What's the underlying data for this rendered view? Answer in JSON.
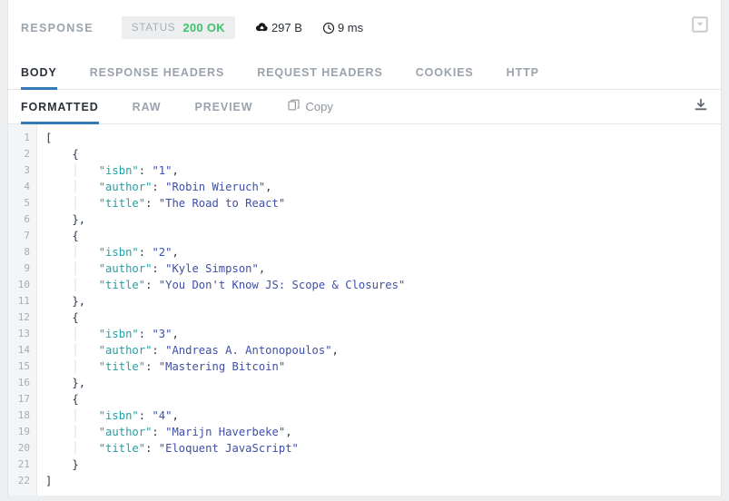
{
  "header": {
    "title": "RESPONSE",
    "status_label": "STATUS",
    "status_code": "200 OK",
    "status_color": "#3ec46d",
    "size": "297 B",
    "size_icon": "cloud-download-icon",
    "time": "9 ms",
    "time_icon": "clock-icon",
    "panel_toggle_icon": "collapse-panel-icon"
  },
  "tabs": [
    {
      "label": "BODY",
      "active": true
    },
    {
      "label": "RESPONSE HEADERS",
      "active": false
    },
    {
      "label": "REQUEST HEADERS",
      "active": false
    },
    {
      "label": "COOKIES",
      "active": false
    },
    {
      "label": "HTTP",
      "active": false
    }
  ],
  "subtabs": [
    {
      "label": "FORMATTED",
      "active": true
    },
    {
      "label": "RAW",
      "active": false
    },
    {
      "label": "PREVIEW",
      "active": false
    }
  ],
  "actions": {
    "copy_label": "Copy",
    "copy_icon": "copy-icon",
    "download_icon": "download-icon"
  },
  "editor": {
    "accent_color": "#337ab7",
    "key_color": "#1fa1a8",
    "string_color": "#3e4fa8",
    "punct_color": "#2f3a4a",
    "line_numbers": [
      1,
      2,
      3,
      4,
      5,
      6,
      7,
      8,
      9,
      10,
      11,
      12,
      13,
      14,
      15,
      16,
      17,
      18,
      19,
      20,
      21,
      22
    ],
    "lines": [
      {
        "n": 1,
        "indent": 0,
        "guide": false,
        "tokens": [
          {
            "t": "punct",
            "v": "["
          }
        ]
      },
      {
        "n": 2,
        "indent": 1,
        "guide": false,
        "tokens": [
          {
            "t": "punct",
            "v": "{"
          }
        ]
      },
      {
        "n": 3,
        "indent": 2,
        "guide": true,
        "tokens": [
          {
            "t": "key",
            "v": "\"isbn\""
          },
          {
            "t": "punct",
            "v": ": "
          },
          {
            "t": "str",
            "v": "\"1\""
          },
          {
            "t": "punct",
            "v": ","
          }
        ]
      },
      {
        "n": 4,
        "indent": 2,
        "guide": true,
        "tokens": [
          {
            "t": "key",
            "v": "\"author\""
          },
          {
            "t": "punct",
            "v": ": "
          },
          {
            "t": "str",
            "v": "\"Robin Wieruch\""
          },
          {
            "t": "punct",
            "v": ","
          }
        ]
      },
      {
        "n": 5,
        "indent": 2,
        "guide": true,
        "tokens": [
          {
            "t": "key",
            "v": "\"title\""
          },
          {
            "t": "punct",
            "v": ": "
          },
          {
            "t": "str",
            "v": "\"The Road to React\""
          }
        ]
      },
      {
        "n": 6,
        "indent": 1,
        "guide": false,
        "tokens": [
          {
            "t": "punct",
            "v": "},"
          }
        ]
      },
      {
        "n": 7,
        "indent": 1,
        "guide": false,
        "tokens": [
          {
            "t": "punct",
            "v": "{"
          }
        ]
      },
      {
        "n": 8,
        "indent": 2,
        "guide": true,
        "tokens": [
          {
            "t": "key",
            "v": "\"isbn\""
          },
          {
            "t": "punct",
            "v": ": "
          },
          {
            "t": "str",
            "v": "\"2\""
          },
          {
            "t": "punct",
            "v": ","
          }
        ]
      },
      {
        "n": 9,
        "indent": 2,
        "guide": true,
        "tokens": [
          {
            "t": "key",
            "v": "\"author\""
          },
          {
            "t": "punct",
            "v": ": "
          },
          {
            "t": "str",
            "v": "\"Kyle Simpson\""
          },
          {
            "t": "punct",
            "v": ","
          }
        ]
      },
      {
        "n": 10,
        "indent": 2,
        "guide": true,
        "tokens": [
          {
            "t": "key",
            "v": "\"title\""
          },
          {
            "t": "punct",
            "v": ": "
          },
          {
            "t": "str",
            "v": "\"You Don't Know JS: Scope & Closures\""
          }
        ]
      },
      {
        "n": 11,
        "indent": 1,
        "guide": false,
        "tokens": [
          {
            "t": "punct",
            "v": "},"
          }
        ]
      },
      {
        "n": 12,
        "indent": 1,
        "guide": false,
        "tokens": [
          {
            "t": "punct",
            "v": "{"
          }
        ]
      },
      {
        "n": 13,
        "indent": 2,
        "guide": true,
        "tokens": [
          {
            "t": "key",
            "v": "\"isbn\""
          },
          {
            "t": "punct",
            "v": ": "
          },
          {
            "t": "str",
            "v": "\"3\""
          },
          {
            "t": "punct",
            "v": ","
          }
        ]
      },
      {
        "n": 14,
        "indent": 2,
        "guide": true,
        "tokens": [
          {
            "t": "key",
            "v": "\"author\""
          },
          {
            "t": "punct",
            "v": ": "
          },
          {
            "t": "str",
            "v": "\"Andreas A. Antonopoulos\""
          },
          {
            "t": "punct",
            "v": ","
          }
        ]
      },
      {
        "n": 15,
        "indent": 2,
        "guide": true,
        "tokens": [
          {
            "t": "key",
            "v": "\"title\""
          },
          {
            "t": "punct",
            "v": ": "
          },
          {
            "t": "str",
            "v": "\"Mastering Bitcoin\""
          }
        ]
      },
      {
        "n": 16,
        "indent": 1,
        "guide": false,
        "tokens": [
          {
            "t": "punct",
            "v": "},"
          }
        ]
      },
      {
        "n": 17,
        "indent": 1,
        "guide": false,
        "tokens": [
          {
            "t": "punct",
            "v": "{"
          }
        ]
      },
      {
        "n": 18,
        "indent": 2,
        "guide": true,
        "tokens": [
          {
            "t": "key",
            "v": "\"isbn\""
          },
          {
            "t": "punct",
            "v": ": "
          },
          {
            "t": "str",
            "v": "\"4\""
          },
          {
            "t": "punct",
            "v": ","
          }
        ]
      },
      {
        "n": 19,
        "indent": 2,
        "guide": true,
        "tokens": [
          {
            "t": "key",
            "v": "\"author\""
          },
          {
            "t": "punct",
            "v": ": "
          },
          {
            "t": "str",
            "v": "\"Marijn Haverbeke\""
          },
          {
            "t": "punct",
            "v": ","
          }
        ]
      },
      {
        "n": 20,
        "indent": 2,
        "guide": true,
        "tokens": [
          {
            "t": "key",
            "v": "\"title\""
          },
          {
            "t": "punct",
            "v": ": "
          },
          {
            "t": "str",
            "v": "\"Eloquent JavaScript\""
          }
        ]
      },
      {
        "n": 21,
        "indent": 1,
        "guide": false,
        "tokens": [
          {
            "t": "punct",
            "v": "}"
          }
        ]
      },
      {
        "n": 22,
        "indent": 0,
        "guide": false,
        "tokens": [
          {
            "t": "punct",
            "v": "]"
          }
        ]
      }
    ],
    "payload": [
      {
        "isbn": "1",
        "author": "Robin Wieruch",
        "title": "The Road to React"
      },
      {
        "isbn": "2",
        "author": "Kyle Simpson",
        "title": "You Don't Know JS: Scope & Closures"
      },
      {
        "isbn": "3",
        "author": "Andreas A. Antonopoulos",
        "title": "Mastering Bitcoin"
      },
      {
        "isbn": "4",
        "author": "Marijn Haverbeke",
        "title": "Eloquent JavaScript"
      }
    ]
  }
}
